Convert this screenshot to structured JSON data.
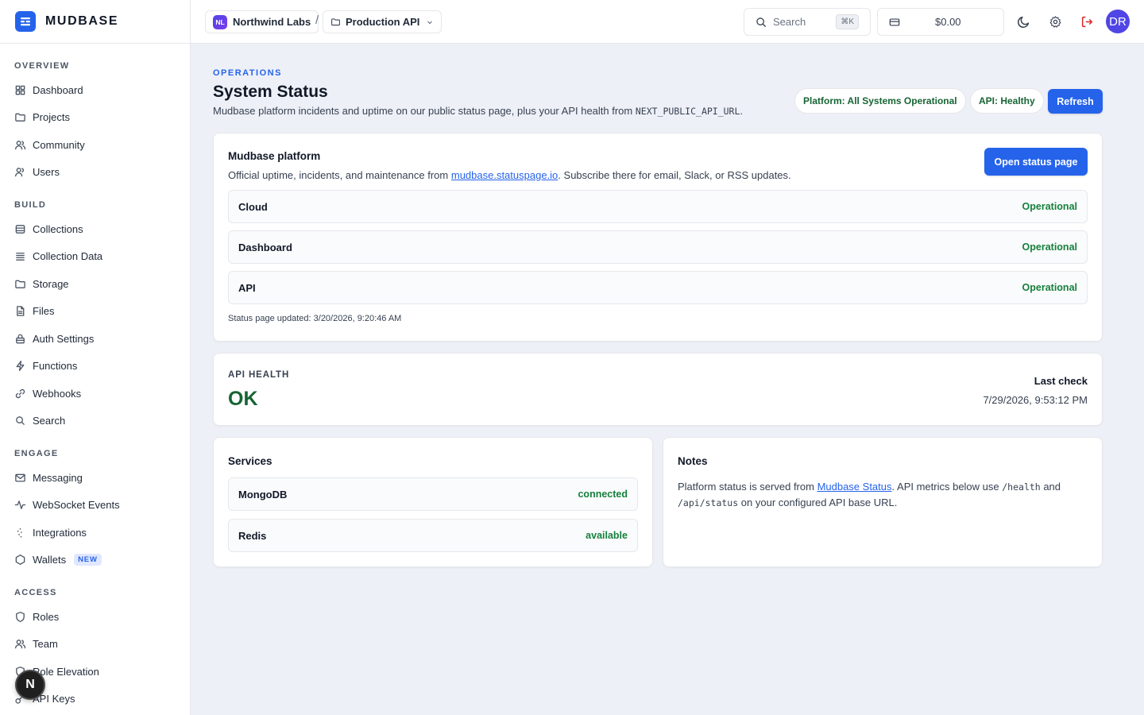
{
  "brand": {
    "name": "MUDBASE"
  },
  "sidebar": {
    "sections": [
      {
        "title": "OVERVIEW",
        "items": [
          {
            "label": "Dashboard",
            "icon": "grid-icon"
          },
          {
            "label": "Projects",
            "icon": "folder-icon"
          },
          {
            "label": "Community",
            "icon": "users-icon"
          },
          {
            "label": "Users",
            "icon": "user-icon"
          }
        ]
      },
      {
        "title": "BUILD",
        "items": [
          {
            "label": "Collections",
            "icon": "database-icon"
          },
          {
            "label": "Collection Data",
            "icon": "list-icon"
          },
          {
            "label": "Storage",
            "icon": "folder-icon"
          },
          {
            "label": "Files",
            "icon": "file-icon"
          },
          {
            "label": "Auth Settings",
            "icon": "lock-icon"
          },
          {
            "label": "Functions",
            "icon": "bolt-icon"
          },
          {
            "label": "Webhooks",
            "icon": "link-icon"
          },
          {
            "label": "Search",
            "icon": "search-icon"
          }
        ]
      },
      {
        "title": "ENGAGE",
        "items": [
          {
            "label": "Messaging",
            "icon": "mail-icon"
          },
          {
            "label": "WebSocket Events",
            "icon": "activity-icon"
          },
          {
            "label": "Integrations",
            "icon": "plug-icon"
          },
          {
            "label": "Wallets",
            "icon": "hexagon-icon",
            "badge": "NEW"
          }
        ]
      },
      {
        "title": "ACCESS",
        "items": [
          {
            "label": "Roles",
            "icon": "shield-icon"
          },
          {
            "label": "Team",
            "icon": "users-icon"
          },
          {
            "label": "Role Elevation",
            "icon": "shield-icon"
          },
          {
            "label": "API Keys",
            "icon": "key-icon"
          }
        ]
      }
    ]
  },
  "topbar": {
    "org": {
      "initials": "NL",
      "name": "Northwind Labs"
    },
    "separator": "/",
    "project": {
      "name": "Production API"
    },
    "search": {
      "placeholder": "Search",
      "shortcut": "⌘K"
    },
    "credits": {
      "amount": "$0.00"
    },
    "user": {
      "initials": "DR"
    }
  },
  "next_badge": "N",
  "page": {
    "eyebrow": "OPERATIONS",
    "title": "System Status",
    "desc_prefix": "Mudbase platform incidents and uptime on our public status page, plus your API health from ",
    "desc_code": "NEXT_PUBLIC_API_URL",
    "desc_suffix": ".",
    "pills": {
      "platform": "Platform: All Systems Operational",
      "api": "API: Healthy"
    },
    "refresh_label": "Refresh"
  },
  "platform_card": {
    "title": "Mudbase platform",
    "desc_prefix": "Official uptime, incidents, and maintenance from ",
    "desc_link": "mudbase.statuspage.io",
    "desc_suffix": ". Subscribe there for email, Slack, or RSS updates.",
    "button": "Open status page",
    "components": [
      {
        "name": "Cloud",
        "status": "Operational"
      },
      {
        "name": "Dashboard",
        "status": "Operational"
      },
      {
        "name": "API",
        "status": "Operational"
      }
    ],
    "updated": "Status page updated: 3/20/2026, 9:20:46 AM"
  },
  "health_card": {
    "label": "API HEALTH",
    "value": "OK",
    "last_check_label": "Last check",
    "last_check_value": "7/29/2026, 9:53:12 PM"
  },
  "services_card": {
    "title": "Services",
    "items": [
      {
        "name": "MongoDB",
        "status": "connected"
      },
      {
        "name": "Redis",
        "status": "available"
      }
    ]
  },
  "notes_card": {
    "title": "Notes",
    "p1": "Platform status is served from ",
    "link": "Mudbase Status",
    "p2": ". API metrics below use ",
    "code1": "/health",
    "p3": " and",
    "code2": "/api/status",
    "p4": " on your configured API base URL."
  },
  "colors": {
    "accent": "#2563eb",
    "success": "#15803d",
    "danger": "#dc2626"
  }
}
